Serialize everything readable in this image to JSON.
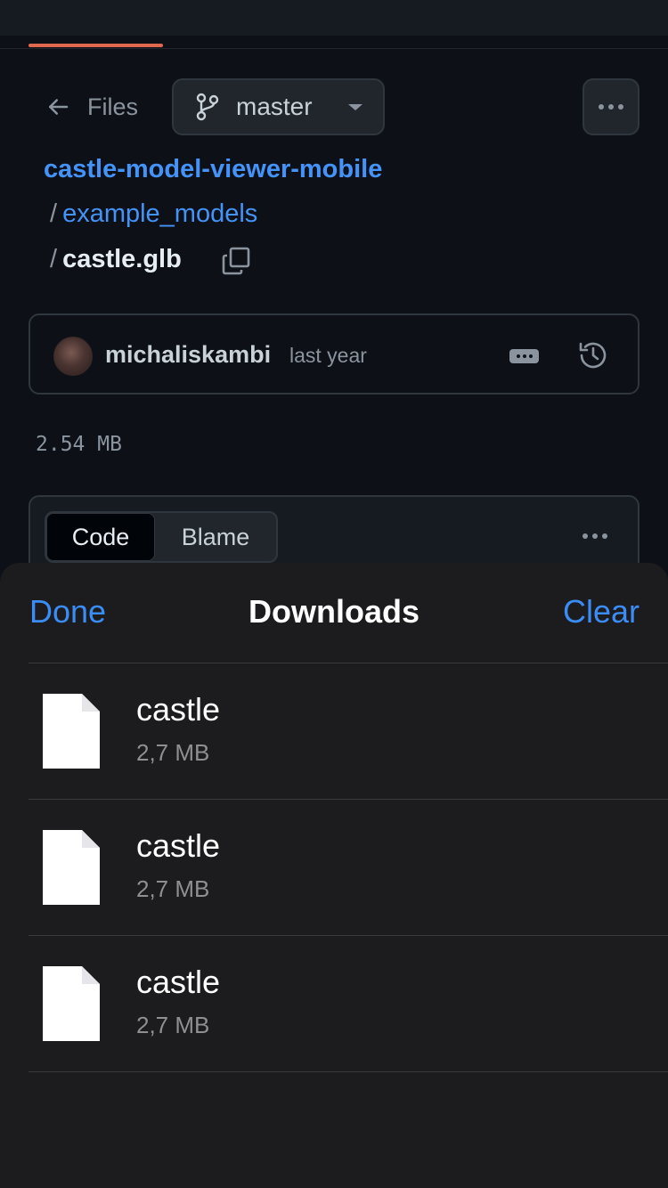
{
  "nav": {
    "back_label": "Files",
    "branch": "master"
  },
  "breadcrumb": {
    "repo": "castle-model-viewer-mobile",
    "separator": "/",
    "folder": "example_models",
    "file": "castle.glb"
  },
  "commit": {
    "author": "michaliskambi",
    "time": "last year"
  },
  "file_size": "2.54 MB",
  "view_tabs": {
    "code": "Code",
    "blame": "Blame"
  },
  "downloads": {
    "done": "Done",
    "title": "Downloads",
    "clear": "Clear",
    "items": [
      {
        "name": "castle",
        "size": "2,7 MB"
      },
      {
        "name": "castle",
        "size": "2,7 MB"
      },
      {
        "name": "castle",
        "size": "2,7 MB"
      }
    ]
  },
  "colors": {
    "accent_link": "#4493f8",
    "ios_blue": "#3b8df5",
    "tab_indicator": "#e0684f",
    "background": "#0d1117",
    "sheet_background": "#1c1c1e"
  }
}
